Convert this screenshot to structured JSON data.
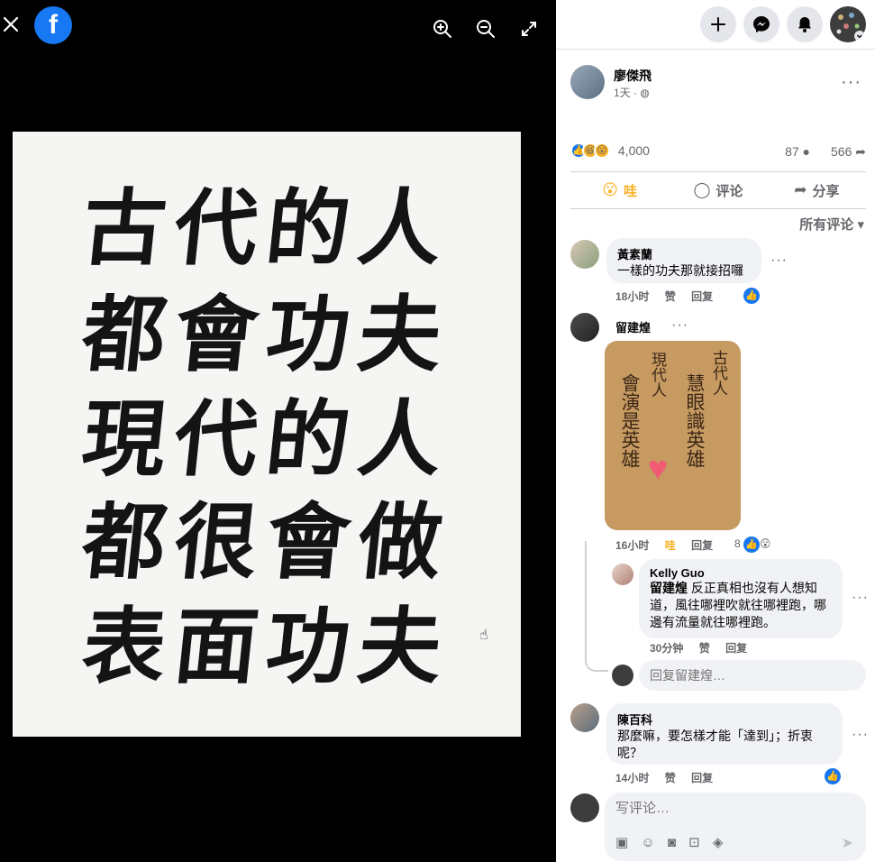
{
  "viewer": {
    "close_icon": "close-icon",
    "logo_letter": "f",
    "zoom_in_icon": "zoom-in-icon",
    "zoom_out_icon": "zoom-out-icon",
    "fullscreen_icon": "fullscreen-icon",
    "photo_lines": [
      "古代的人",
      "都會功夫",
      "現代的人",
      "都很會做",
      "表面功夫"
    ]
  },
  "topbar": {
    "create_icon": "plus-icon",
    "messenger_icon": "messenger-icon",
    "notification_icon": "bell-icon",
    "account_icon": "account-avatar"
  },
  "post": {
    "author": "廖傑飛",
    "time": "1天 ·",
    "privacy_icon": "globe-icon",
    "more": "···",
    "reactions_count": "4,000",
    "comments_count": "87",
    "shares_count": "566"
  },
  "actions": {
    "react_label": "哇",
    "comment_label": "评论",
    "share_label": "分享"
  },
  "sort_label": "所有评论 ▾",
  "comments": [
    {
      "name": "黃素蘭",
      "text": "一樣的功夫那就接招囉",
      "time": "18小时",
      "like_label": "赞",
      "reply_label": "回复"
    },
    {
      "name": "留建煌",
      "sticker_cols": [
        "古代人",
        "慧眼識英雄",
        "現代人",
        "會演是英雄"
      ],
      "time": "16小时",
      "like_label": "哇",
      "reply_label": "回复",
      "reaction_count": "8"
    },
    {
      "name": "Kelly Guo",
      "mention": "留建煌",
      "text": " 反正真相也沒有人想知道，風往哪裡吹就往哪裡跑，哪邊有流量就往哪裡跑。",
      "time": "30分钟",
      "like_label": "赞",
      "reply_label": "回复"
    },
    {
      "name": "陳百科",
      "text": "那麼嘛，要怎樣才能「達到」；折衷呢？",
      "time": "14小时",
      "like_label": "赞",
      "reply_label": "回复"
    }
  ],
  "reply_placeholder": "回复留建煌…",
  "composer": {
    "placeholder": "写评论…",
    "tools": [
      "sticker-icon",
      "emoji-icon",
      "camera-icon",
      "gif-icon",
      "avatar-sticker-icon"
    ],
    "send_icon": "send-icon"
  }
}
